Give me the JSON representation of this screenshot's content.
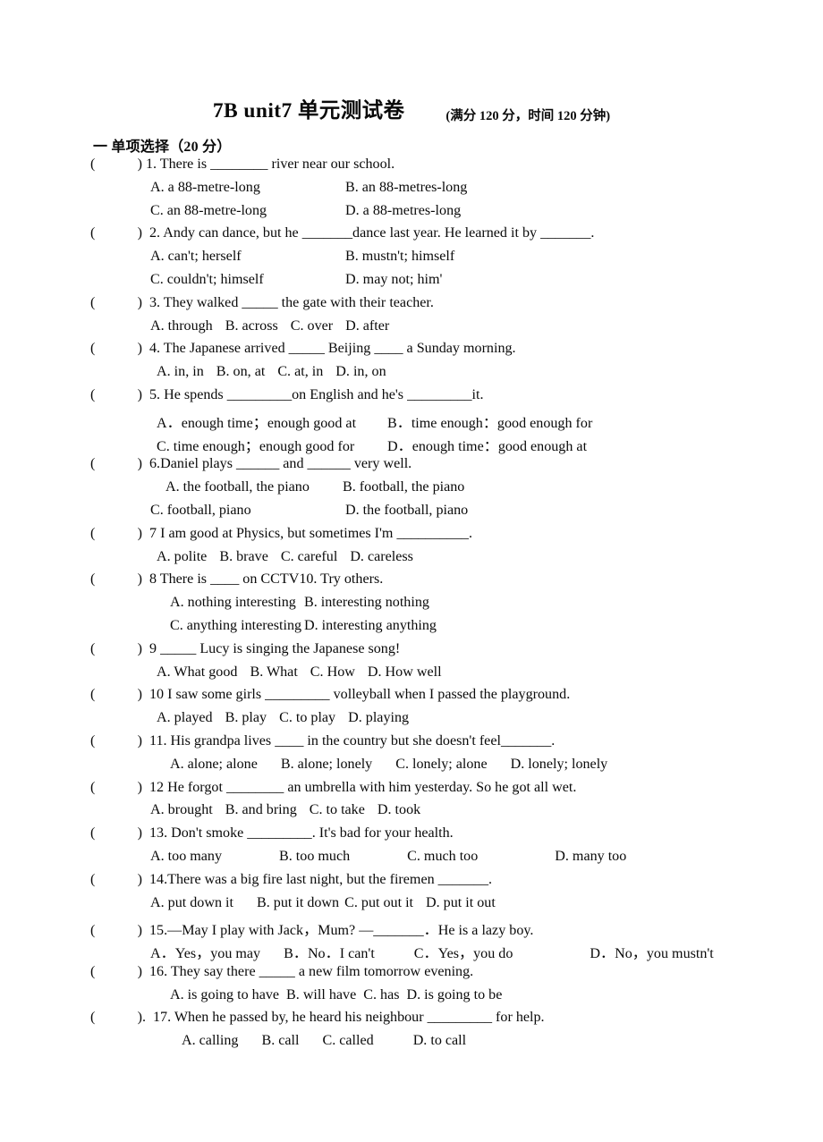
{
  "document": {
    "title": "7B unit7 单元测试卷",
    "subtitle": "(满分 120 分，时间  120 分钟)"
  },
  "sections": [
    {
      "heading": "一  单项选择（20 分）",
      "bracket_open": "（",
      "bracket_close": "）"
    }
  ],
  "questions": [
    {
      "number": "1.",
      "stem": "1. There is ________ river near our school.",
      "bracket_open": "(",
      "bracket_close": ")",
      "rows": [
        {
          "a": "A. a 88-metre-long",
          "b": "B. an 88-metres-long"
        },
        {
          "a": "C. an 88-metre-long",
          "b": "D. a 88-metres-long"
        }
      ]
    },
    {
      "number": "2.",
      "stem": "2. Andy can dance, but he _______dance last year. He learned it by _______.",
      "bracket_open": "(",
      "bracket_close": ")",
      "rows": [
        {
          "a": "A. can't; herself",
          "b": "B. mustn't; himself"
        },
        {
          "a": "C. couldn't; himself",
          "b": "D. may not; him'"
        }
      ]
    },
    {
      "number": "3.",
      "stem": "3. They walked _____ the gate with their teacher.",
      "bracket_open": "(",
      "bracket_close": ")",
      "inline": [
        "A. through",
        "B. across",
        "C. over",
        "D. after"
      ]
    },
    {
      "number": "4.",
      "stem": "4. The Japanese arrived _____ Beijing ____ a Sunday morning.",
      "bracket_open": "(",
      "bracket_close": ")",
      "inline": [
        "A. in, in",
        "B. on, at",
        "C. at, in",
        "D. in, on"
      ]
    },
    {
      "number": "5.",
      "stem": "5. He spends _________on English and he's _________it.",
      "bracket_open": "(",
      "bracket_close": ")",
      "rows": [
        {
          "a": "A．enough time；enough good at",
          "b": "B．time enough：good enough for"
        },
        {
          "a": "C. time enough；enough good for",
          "b": "D．enough time：good enough at"
        }
      ]
    },
    {
      "number": "6.",
      "stem": "6.Daniel plays ______ and ______ very well.",
      "bracket_open": "(",
      "bracket_close": ")",
      "rows": [
        {
          "a": "A. the football, the piano",
          "b": "B. football, the piano"
        },
        {
          "a": "C. football, piano",
          "b": "D. the football, piano"
        }
      ]
    },
    {
      "number": "7",
      "stem": "7   I am good at Physics, but sometimes I'm __________.",
      "bracket_open": "(",
      "bracket_close": ")",
      "inline": [
        "A. polite",
        "B. brave",
        "C. careful",
        "D. careless"
      ]
    },
    {
      "number": "8",
      "stem": "8 There is ____ on CCTV10. Try others.",
      "bracket_open": "(",
      "bracket_close": ")",
      "rows": [
        {
          "a": "A. nothing interesting",
          "b": "B. interesting nothing"
        },
        {
          "a": "C. anything interesting",
          "b": "D. interesting anything"
        }
      ]
    },
    {
      "number": "9",
      "stem": "9     _____ Lucy is singing the Japanese song!",
      "bracket_open": "(",
      "bracket_close": ")",
      "inline": [
        "A. What good",
        "B. What",
        "C. How",
        "D. How well"
      ]
    },
    {
      "number": "10",
      "stem": "10   I saw some girls _________ volleyball when I passed the playground.",
      "bracket_open": "(",
      "bracket_close": ")",
      "inline": [
        "A. played",
        "B. play",
        "C. to play",
        "D. playing"
      ]
    },
    {
      "number": "11.",
      "stem": "11. His grandpa lives ____ in the country but she doesn't feel_______.",
      "bracket_open": "(",
      "bracket_close": ")",
      "inline": [
        "A. alone; alone",
        "B. alone; lonely",
        "C. lonely; alone",
        "D. lonely; lonely"
      ]
    },
    {
      "number": "12",
      "stem": "12   He forgot ________ an umbrella with him yesterday. So he got all wet.",
      "bracket_open": "(",
      "bracket_close": ")",
      "inline": [
        "A. brought",
        "B. and bring",
        "C. to take",
        "D. took"
      ]
    },
    {
      "number": "13.",
      "stem": "13. Don't smoke _________. It's bad for your health.",
      "bracket_open": "(",
      "bracket_close": ")",
      "inline": [
        "A. too many",
        "B. too much",
        "C. much too",
        "D. many too"
      ]
    },
    {
      "number": "14.",
      "stem": "14.There was a big fire last night, but the firemen _______.",
      "bracket_open": "(",
      "bracket_close": ")",
      "inline": [
        "A. put down it",
        "B. put it down",
        "C. put out it",
        "D. put it out"
      ]
    },
    {
      "number": "15.",
      "stem": "15.—May I play with Jack，Mum? —_______．He is a lazy boy.",
      "bracket_open": "(",
      "bracket_close": ")",
      "inline": [
        "A．Yes，you may",
        "B．No．I can't",
        "C．Yes，you do",
        "D．No，you mustn't"
      ]
    },
    {
      "number": "16.",
      "stem": "16. They say there _____ a new film tomorrow evening.",
      "bracket_open": "(",
      "bracket_close": ")",
      "inline": [
        "A. is going to have",
        "B. will have",
        "C. has",
        "D. is going to be"
      ]
    },
    {
      "number": "17.",
      "stem": "17. When he passed by, he heard his neighbour _________ for help.",
      "bracket_open": "(",
      "bracket_close": ").",
      "inline": [
        "A. calling",
        "B. call",
        "C. called",
        "D. to call"
      ]
    }
  ]
}
